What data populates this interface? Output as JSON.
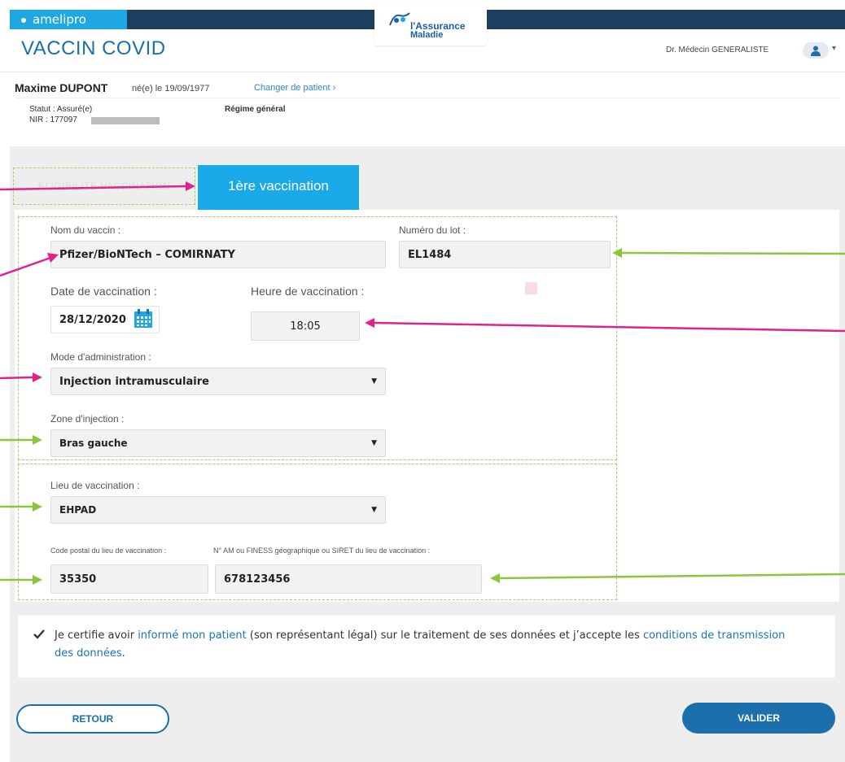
{
  "header": {
    "brand": "amelipro",
    "logo_line1": "l'Assurance",
    "logo_line2": "Maladie",
    "app_title": "VACCIN COVID",
    "doctor": "Dr. Médecin GENERALISTE",
    "colors": {
      "top_bar": "#1d3e5e",
      "brand": "#1ea7e1",
      "accent": "#1b6fad"
    }
  },
  "patient": {
    "name": "Maxime DUPONT",
    "dob": "né(e) le 19/09/1977",
    "change_label": "Changer de patient ›",
    "statut": "Statut : Assuré(e)",
    "nir": "NIR : 177097",
    "regime": "Régime général"
  },
  "tabs": {
    "eligibilite": "ELIGIBILITE VACCINATION",
    "active": "1ère vaccination"
  },
  "form": {
    "vaccine_label": "Nom du vaccin :",
    "vaccine_value": "Pfizer/BioNTech – COMIRNATY",
    "lot_label": "Numéro du lot :",
    "lot_value": "EL1484",
    "date_label": "Date de vaccination :",
    "date_value": "28/12/2020",
    "time_label": "Heure de vaccination :",
    "time_value": "18:05",
    "mode_label": "Mode d'administration :",
    "mode_value": "Injection intramusculaire",
    "zone_label": "Zone d'injection :",
    "zone_value": "Bras gauche",
    "lieu_label": "Lieu de vaccination :",
    "lieu_value": "EHPAD",
    "cp_label": "Code postal du lieu de vaccination :",
    "cp_value": "35350",
    "siret_label": "N° AM ou FINESS géographique ou SIRET du lieu de vaccination :",
    "siret_value": "678123456"
  },
  "consent": {
    "checked": true,
    "part1": "Je certifie avoir ",
    "link1": "informé mon patient",
    "part2": " (son représentant légal) sur le traitement de ses données et j’accepte les ",
    "link2": "conditions de transmission des données",
    "part3": "."
  },
  "buttons": {
    "retour": "RETOUR",
    "valider": "VALIDER"
  },
  "annotation_colors": {
    "pink": "#e0228a",
    "green": "#8cc63f"
  }
}
